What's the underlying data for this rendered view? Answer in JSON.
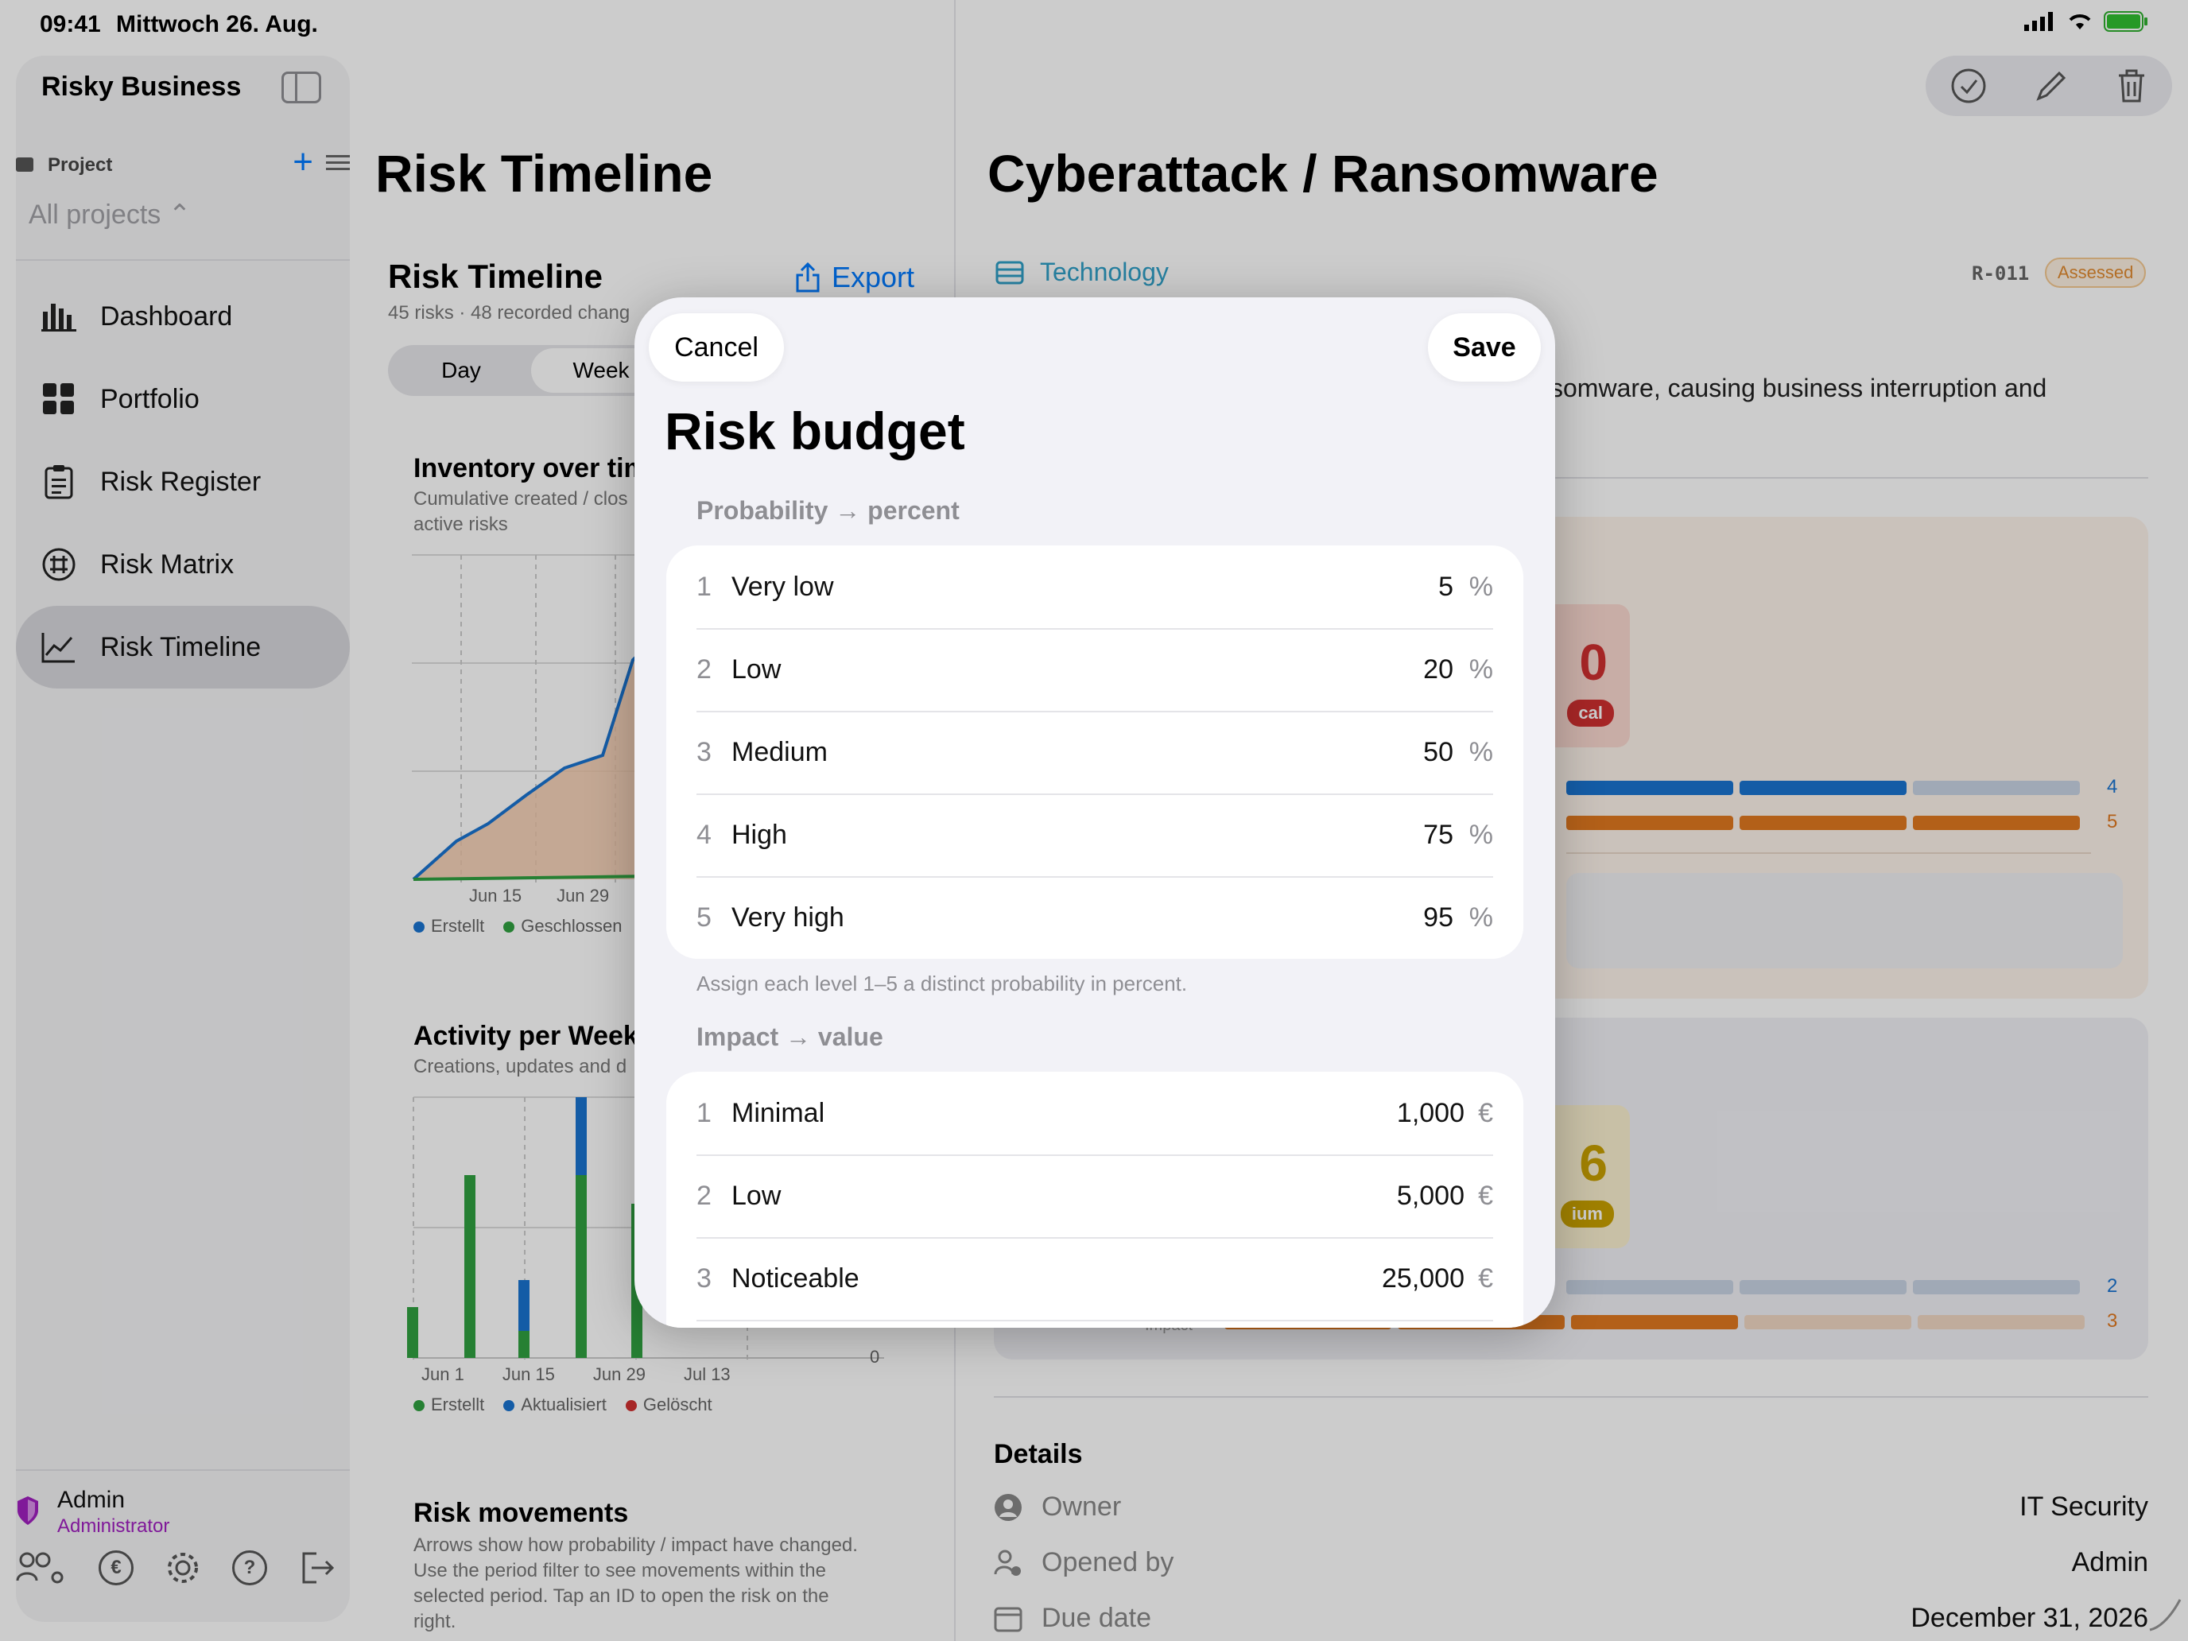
{
  "status_bar": {
    "time": "09:41",
    "date": "Mittwoch 26. Aug."
  },
  "sidebar": {
    "app_title": "Risky Business",
    "project_label": "Project",
    "project_select": "All projects ⌃",
    "items": [
      {
        "label": "Dashboard",
        "icon": "bar-chart-icon"
      },
      {
        "label": "Portfolio",
        "icon": "grid-icon"
      },
      {
        "label": "Risk Register",
        "icon": "clipboard-icon"
      },
      {
        "label": "Risk Matrix",
        "icon": "matrix-icon"
      },
      {
        "label": "Risk Timeline",
        "icon": "timeline-icon",
        "active": true
      }
    ],
    "user_name": "Admin",
    "user_role": "Administrator",
    "currency_symbol": "€",
    "help_symbol": "?"
  },
  "middle": {
    "page_title": "Risk Timeline",
    "section_title": "Risk Timeline",
    "section_sub": "45 risks · 48 recorded chang",
    "export_label": "Export",
    "segments": [
      "Day",
      "Week"
    ],
    "inventory": {
      "title": "Inventory over tim",
      "sub1": "Cumulative created / clos",
      "sub2": "active risks",
      "x_labels": [
        "Jun 15",
        "Jun 29",
        "J"
      ],
      "legend": [
        "Erstellt",
        "Geschlossen"
      ]
    },
    "activity": {
      "title": "Activity per Week",
      "sub": "Creations, updates and d",
      "x_labels": [
        "Jun 1",
        "Jun 15",
        "Jun 29",
        "Jul 13"
      ],
      "zero_label": "0",
      "legend": [
        "Erstellt",
        "Aktualisiert",
        "Gelöscht"
      ]
    },
    "movements": {
      "title": "Risk movements",
      "sub": [
        "Arrows show how probability / impact have changed.",
        "Use the period filter to see movements within the",
        "selected period. Tap an ID to open the risk on the",
        "right."
      ]
    }
  },
  "right": {
    "title": "Cyberattack / Ransomware",
    "category": "Technology",
    "risk_id": "R-011",
    "status": "Assessed",
    "description": "somware, causing business interruption and",
    "panel1": {
      "score": "0",
      "level": "cal",
      "prob_value": "4",
      "impact_value": "5"
    },
    "panel2": {
      "score": "6",
      "level": "ium",
      "prob_value": "2",
      "impact_value": "3",
      "row_label": "Impact"
    },
    "details_title": "Details",
    "details": [
      {
        "label": "Owner",
        "value": "IT Security"
      },
      {
        "label": "Opened by",
        "value": "Admin"
      },
      {
        "label": "Due date",
        "value": "December 31, 2026"
      }
    ]
  },
  "modal": {
    "cancel": "Cancel",
    "save": "Save",
    "title": "Risk budget",
    "prob_section": "Probability → percent",
    "prob_rows": [
      {
        "num": "1",
        "label": "Very low",
        "value": "5",
        "unit": "%"
      },
      {
        "num": "2",
        "label": "Low",
        "value": "20",
        "unit": "%"
      },
      {
        "num": "3",
        "label": "Medium",
        "value": "50",
        "unit": "%"
      },
      {
        "num": "4",
        "label": "High",
        "value": "75",
        "unit": "%"
      },
      {
        "num": "5",
        "label": "Very high",
        "value": "95",
        "unit": "%"
      }
    ],
    "prob_footer": "Assign each level 1–5 a distinct probability in percent.",
    "impact_section": "Impact → value",
    "impact_rows": [
      {
        "num": "1",
        "label": "Minimal",
        "value": "1,000",
        "unit": "€"
      },
      {
        "num": "2",
        "label": "Low",
        "value": "5,000",
        "unit": "€"
      },
      {
        "num": "3",
        "label": "Noticeable",
        "value": "25,000",
        "unit": "€"
      }
    ]
  },
  "colors": {
    "accent": "#007aff",
    "created": "#30a040",
    "updated": "#1a73d0",
    "deleted": "#d03030",
    "critical": "#d03030",
    "orange": "#e07820",
    "medium": "#c8a000"
  }
}
